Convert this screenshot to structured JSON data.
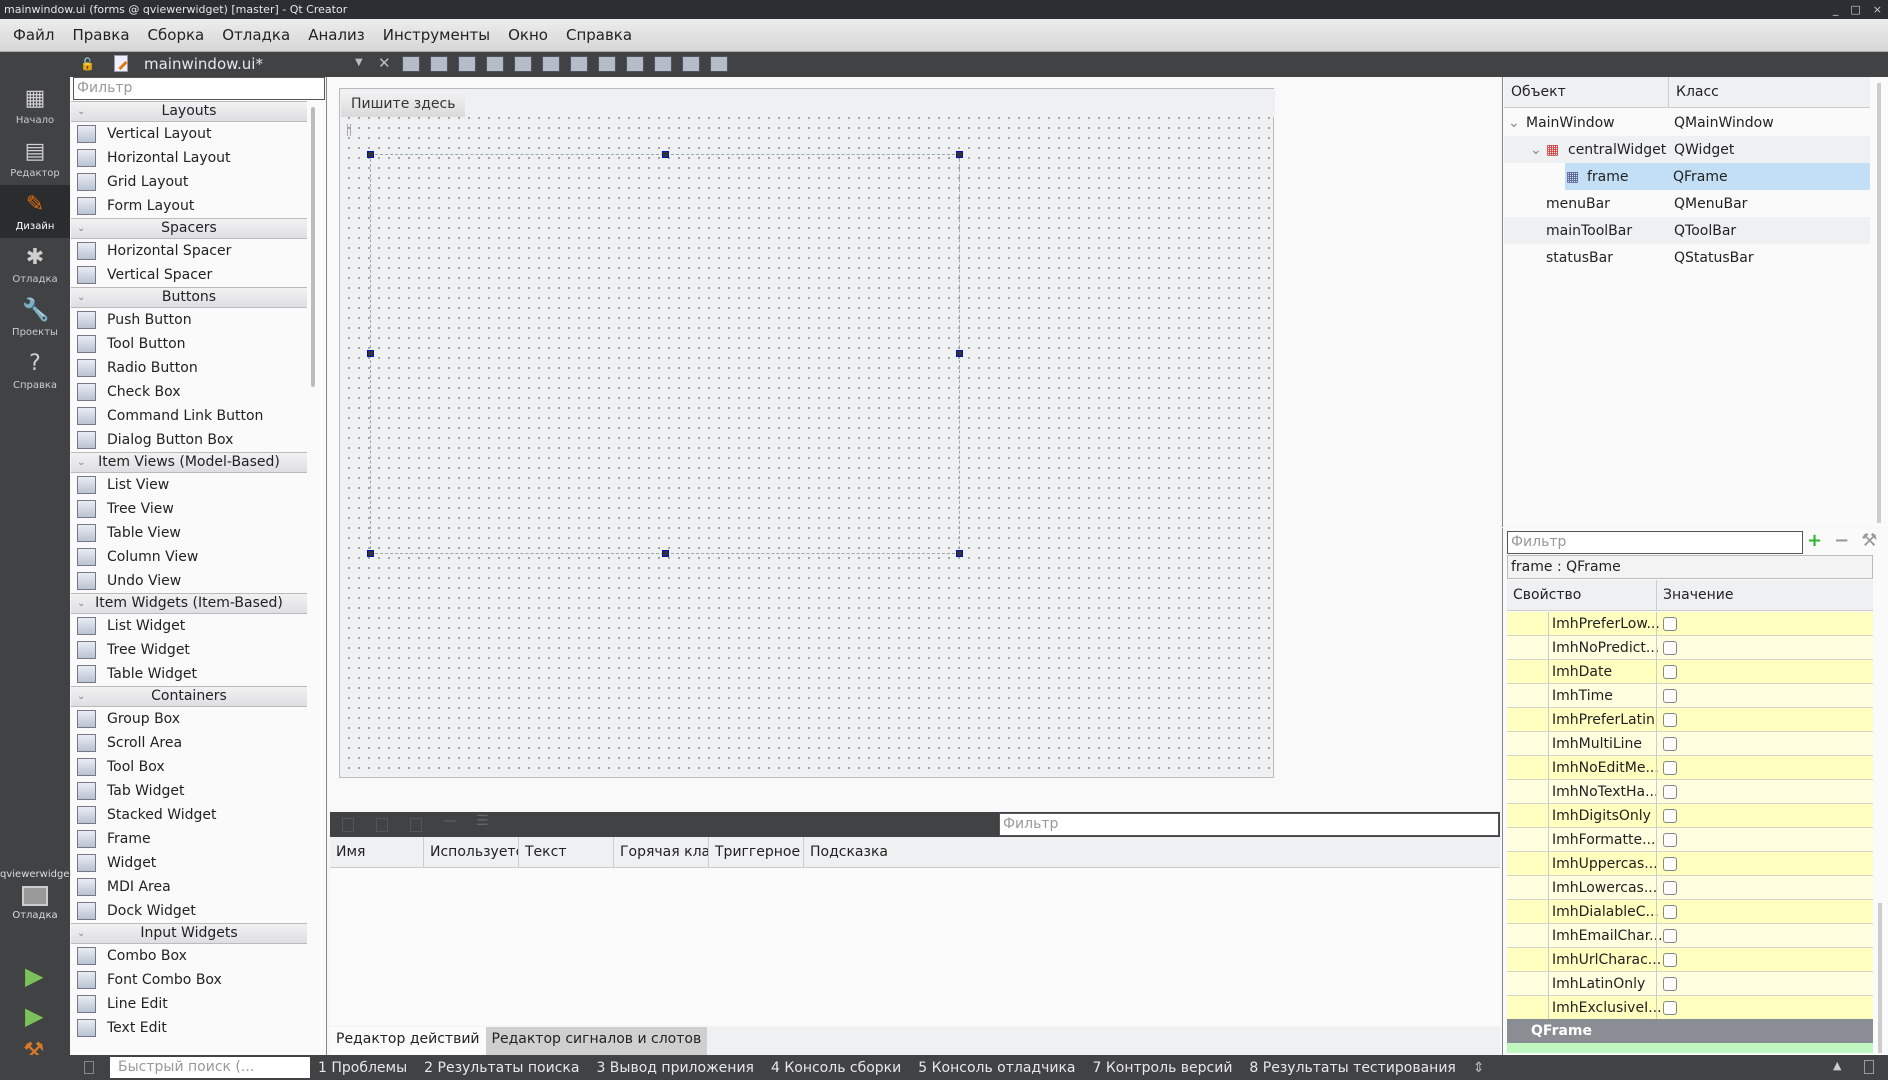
{
  "window": {
    "title": "mainwindow.ui (forms @ qviewerwidget) [master] - Qt Creator",
    "controls": [
      "_",
      "□",
      "×"
    ]
  },
  "menubar": [
    "Файл",
    "Правка",
    "Сборка",
    "Отладка",
    "Анализ",
    "Инструменты",
    "Окно",
    "Справка"
  ],
  "editorbar": {
    "filename": "mainwindow.ui*"
  },
  "modes": [
    {
      "label": "Начало",
      "icon": "grid-icon"
    },
    {
      "label": "Редактор",
      "icon": "document-icon"
    },
    {
      "label": "Дизайн",
      "icon": "pencil-icon",
      "active": true
    },
    {
      "label": "Отладка",
      "icon": "bug-icon"
    },
    {
      "label": "Проекты",
      "icon": "wrench-icon"
    },
    {
      "label": "Справка",
      "icon": "help-icon"
    }
  ],
  "kit": {
    "project": "qviewerwidget",
    "build": "Отладка"
  },
  "widgetbox": {
    "filter_placeholder": "Фильтр",
    "categories": [
      {
        "name": "Layouts",
        "items": [
          "Vertical Layout",
          "Horizontal Layout",
          "Grid Layout",
          "Form Layout"
        ]
      },
      {
        "name": "Spacers",
        "items": [
          "Horizontal Spacer",
          "Vertical Spacer"
        ]
      },
      {
        "name": "Buttons",
        "items": [
          "Push Button",
          "Tool Button",
          "Radio Button",
          "Check Box",
          "Command Link Button",
          "Dialog Button Box"
        ]
      },
      {
        "name": "Item Views (Model-Based)",
        "items": [
          "List View",
          "Tree View",
          "Table View",
          "Column View",
          "Undo View"
        ]
      },
      {
        "name": "Item Widgets (Item-Based)",
        "items": [
          "List Widget",
          "Tree Widget",
          "Table Widget"
        ]
      },
      {
        "name": "Containers",
        "items": [
          "Group Box",
          "Scroll Area",
          "Tool Box",
          "Tab Widget",
          "Stacked Widget",
          "Frame",
          "Widget",
          "MDI Area",
          "Dock Widget"
        ]
      },
      {
        "name": "Input Widgets",
        "items": [
          "Combo Box",
          "Font Combo Box",
          "Line Edit",
          "Text Edit"
        ]
      }
    ]
  },
  "form": {
    "menu_placeholder": "Пишите здесь"
  },
  "action_editor": {
    "filter_placeholder": "Фильтр",
    "columns": [
      "Имя",
      "Используетс",
      "Текст",
      "Горячая кла",
      "Триггерное",
      "Подсказка"
    ],
    "tabs": [
      "Редактор действий",
      "Редактор сигналов и слотов"
    ]
  },
  "object_inspector": {
    "columns": [
      "Объект",
      "Класс"
    ],
    "rows": [
      {
        "name": "MainWindow",
        "class": "QMainWindow"
      },
      {
        "name": "centralWidget",
        "class": "QWidget"
      },
      {
        "name": "frame",
        "class": "QFrame",
        "selected": true
      },
      {
        "name": "menuBar",
        "class": "QMenuBar"
      },
      {
        "name": "mainToolBar",
        "class": "QToolBar"
      },
      {
        "name": "statusBar",
        "class": "QStatusBar"
      }
    ]
  },
  "property_editor": {
    "filter_placeholder": "Фильтр",
    "object_class": "frame : QFrame",
    "columns": [
      "Свойство",
      "Значение"
    ],
    "properties": [
      "ImhPreferLow...",
      "ImhNoPredict...",
      "ImhDate",
      "ImhTime",
      "ImhPreferLatin",
      "ImhMultiLine",
      "ImhNoEditMe...",
      "ImhNoTextHa...",
      "ImhDigitsOnly",
      "ImhFormatte...",
      "ImhUppercas...",
      "ImhLowercas...",
      "ImhDialableC...",
      "ImhEmailChar...",
      "ImhUrlCharac...",
      "ImhLatinOnly",
      "ImhExclusiveI..."
    ],
    "group": "QFrame"
  },
  "statusbar": {
    "search_placeholder": "Быстрый поиск (...",
    "panes": [
      "1 Проблемы",
      "2 Результаты поиска",
      "3 Вывод приложения",
      "4 Консоль сборки",
      "5 Консоль отладчика",
      "7 Контроль версий",
      "8 Результаты тестирования"
    ]
  }
}
